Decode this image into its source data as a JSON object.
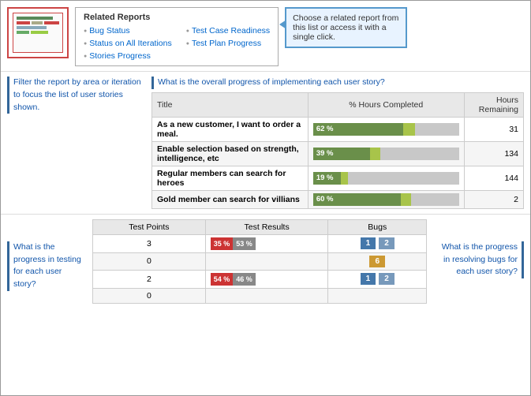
{
  "header": {
    "related_reports_title": "Related Reports",
    "reports_left": [
      "Bug Status",
      "Status on All Iterations",
      "Stories Progress"
    ],
    "reports_right": [
      "Test Case Readiness",
      "Test Plan Progress"
    ],
    "callout_text": "Choose a related report from this list or access it with a single click."
  },
  "filter_note": "Filter the report by area or iteration to focus the list of user stories shown.",
  "progress_note": "What is the overall progress of implementing each user story?",
  "stories_table": {
    "col_title": "Title",
    "col_progress": "% Hours Completed",
    "col_hours": "Hours Remaining",
    "rows": [
      {
        "title": "As a new customer, I want to order a meal.",
        "pct": 62,
        "accent": 8,
        "label": "62 %",
        "hours": "31"
      },
      {
        "title": "Enable selection based on strength, intelligence, etc",
        "pct": 39,
        "accent": 7,
        "label": "39 %",
        "hours": "134"
      },
      {
        "title": "Regular members can search for heroes",
        "pct": 19,
        "accent": 5,
        "label": "19 %",
        "hours": "144"
      },
      {
        "title": "Gold member can search for villians",
        "pct": 60,
        "accent": 7,
        "label": "60 %",
        "hours": "2"
      }
    ]
  },
  "testing_note": "What is the progress in testing for each user story?",
  "test_table": {
    "col_points": "Test Points",
    "col_results": "Test Results",
    "col_bugs": "Bugs",
    "rows": [
      {
        "points": "3",
        "red_pct": "35 %",
        "gray_pct": "53 %",
        "bugs": [
          {
            "val": "1",
            "type": "blue"
          },
          {
            "val": "2",
            "type": "steel"
          }
        ]
      },
      {
        "points": "0",
        "red_pct": "",
        "gray_pct": "",
        "bugs": [
          {
            "val": "6",
            "type": "gold"
          }
        ]
      },
      {
        "points": "2",
        "red_pct": "54 %",
        "gray_pct": "46 %",
        "bugs": [
          {
            "val": "1",
            "type": "blue"
          },
          {
            "val": "2",
            "type": "steel"
          }
        ]
      },
      {
        "points": "0",
        "red_pct": "",
        "gray_pct": "",
        "bugs": []
      }
    ]
  },
  "bugs_note": "What is the progress in resolving bugs for each user story?"
}
